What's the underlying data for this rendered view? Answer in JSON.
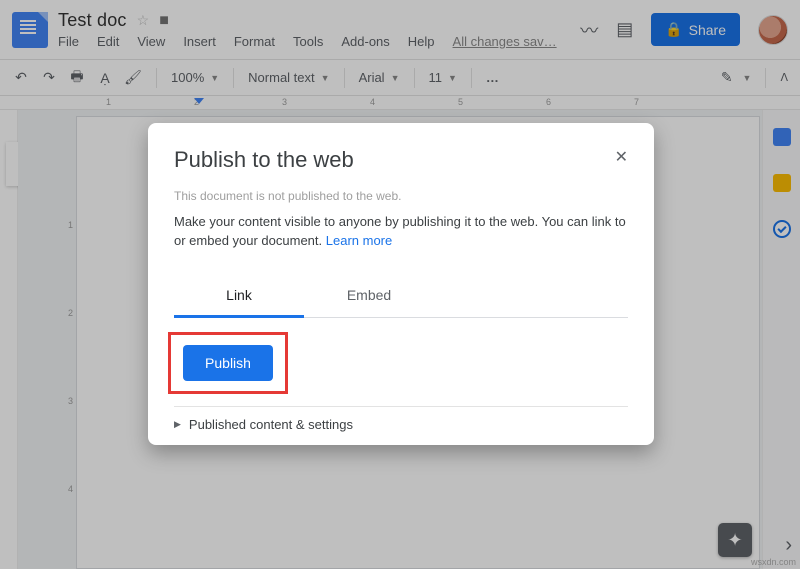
{
  "header": {
    "doc_title": "Test doc",
    "menus": [
      "File",
      "Edit",
      "View",
      "Insert",
      "Format",
      "Tools",
      "Add-ons",
      "Help"
    ],
    "save_status": "All changes sav…",
    "share_label": "Share"
  },
  "toolbar": {
    "zoom": "100%",
    "style": "Normal text",
    "font": "Arial",
    "font_size": "11",
    "more": "…"
  },
  "ruler": {
    "marks": [
      "1",
      "2",
      "3",
      "4",
      "5",
      "6",
      "7"
    ]
  },
  "dialog": {
    "title": "Publish to the web",
    "subtitle": "This document is not published to the web.",
    "body": "Make your content visible to anyone by publishing it to the web. You can link to or embed your document.",
    "learn_more": "Learn more",
    "tabs": {
      "link": "Link",
      "embed": "Embed"
    },
    "publish_label": "Publish",
    "settings_row": "Published content & settings"
  },
  "watermark": "wsxdn.com"
}
